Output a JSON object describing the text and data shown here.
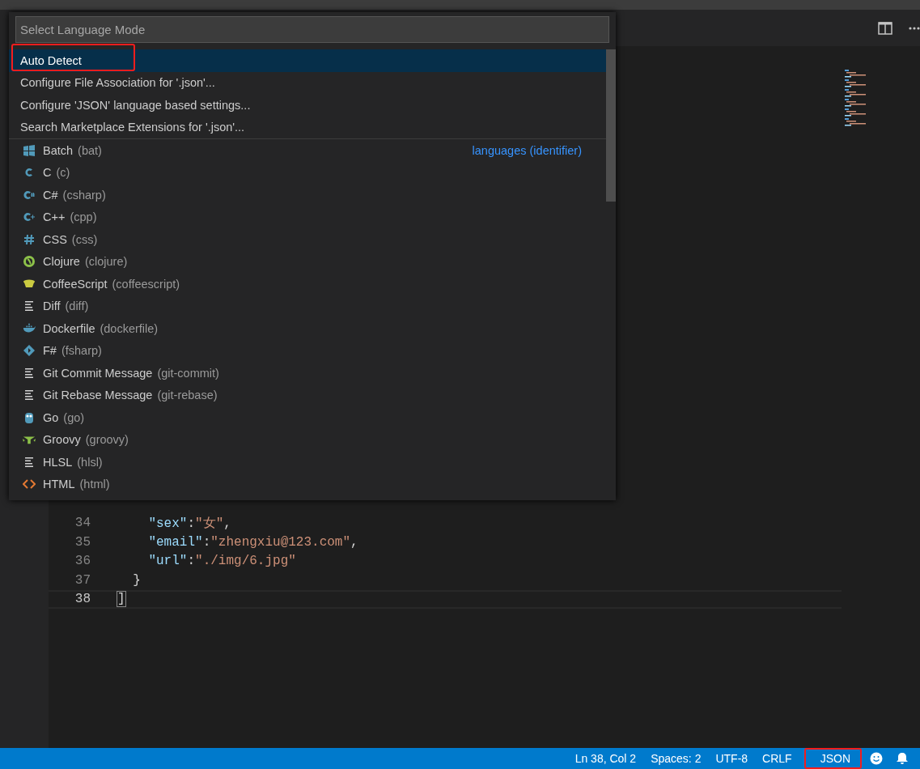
{
  "quick_pick": {
    "placeholder": "Select Language Mode",
    "commands": [
      {
        "label": "Auto Detect",
        "selected": true,
        "highlighted": true
      },
      {
        "label": "Configure File Association for '.json'...",
        "selected": false,
        "highlighted": false
      },
      {
        "label": "Configure 'JSON' language based settings...",
        "selected": false,
        "highlighted": false
      },
      {
        "label": "Search Marketplace Extensions for '.json'...",
        "selected": false,
        "highlighted": false
      }
    ],
    "group_label": "languages (identifier)",
    "languages": [
      {
        "name": "Batch",
        "id": "(bat)"
      },
      {
        "name": "C",
        "id": "(c)"
      },
      {
        "name": "C#",
        "id": "(csharp)"
      },
      {
        "name": "C++",
        "id": "(cpp)"
      },
      {
        "name": "CSS",
        "id": "(css)"
      },
      {
        "name": "Clojure",
        "id": "(clojure)"
      },
      {
        "name": "CoffeeScript",
        "id": "(coffeescript)"
      },
      {
        "name": "Diff",
        "id": "(diff)"
      },
      {
        "name": "Dockerfile",
        "id": "(dockerfile)"
      },
      {
        "name": "F#",
        "id": "(fsharp)"
      },
      {
        "name": "Git Commit Message",
        "id": "(git-commit)"
      },
      {
        "name": "Git Rebase Message",
        "id": "(git-rebase)"
      },
      {
        "name": "Go",
        "id": "(go)"
      },
      {
        "name": "Groovy",
        "id": "(groovy)"
      },
      {
        "name": "HLSL",
        "id": "(hlsl)"
      },
      {
        "name": "HTML",
        "id": "(html)"
      }
    ]
  },
  "editor": {
    "lines": [
      {
        "number": "34",
        "current": false,
        "tokens": [
          {
            "kind": "key",
            "text": "    \"sex\""
          },
          {
            "kind": "punct",
            "text": ":"
          },
          {
            "kind": "string",
            "text": "\"女\""
          },
          {
            "kind": "punct",
            "text": ","
          }
        ]
      },
      {
        "number": "35",
        "current": false,
        "tokens": [
          {
            "kind": "key",
            "text": "    \"email\""
          },
          {
            "kind": "punct",
            "text": ":"
          },
          {
            "kind": "string",
            "text": "\"zhengxiu@123.com\""
          },
          {
            "kind": "punct",
            "text": ","
          }
        ]
      },
      {
        "number": "36",
        "current": false,
        "tokens": [
          {
            "kind": "key",
            "text": "    \"url\""
          },
          {
            "kind": "punct",
            "text": ":"
          },
          {
            "kind": "string",
            "text": "\"./img/6.jpg\""
          }
        ]
      },
      {
        "number": "37",
        "current": false,
        "tokens": [
          {
            "kind": "punct",
            "text": "  }"
          }
        ]
      },
      {
        "number": "38",
        "current": true,
        "tokens": [
          {
            "kind": "bracket",
            "text": "]"
          }
        ]
      }
    ]
  },
  "status_bar": {
    "items": [
      {
        "label": "Ln 38, Col 2",
        "highlighted": false
      },
      {
        "label": "Spaces: 2",
        "highlighted": false
      },
      {
        "label": "UTF-8",
        "highlighted": false
      },
      {
        "label": "CRLF",
        "highlighted": false
      },
      {
        "label": "JSON",
        "highlighted": true
      }
    ]
  }
}
